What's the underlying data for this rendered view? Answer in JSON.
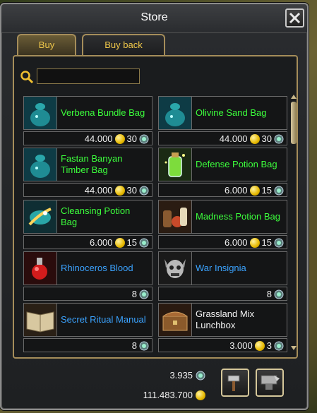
{
  "window": {
    "title": "Store"
  },
  "tabs": [
    {
      "label": "Buy",
      "active": true
    },
    {
      "label": "Buy back",
      "active": false
    }
  ],
  "search": {
    "value": "",
    "placeholder": ""
  },
  "items": [
    {
      "name": "Verbena Bundle Bag",
      "gold": "44.000",
      "gems": "30",
      "color": "green",
      "icon": "seed-bag-icon"
    },
    {
      "name": "Olivine Sand Bag",
      "gold": "44.000",
      "gems": "30",
      "color": "green",
      "icon": "seed-bag-icon"
    },
    {
      "name": "Fastan Banyan Timber Bag",
      "gold": "44.000",
      "gems": "30",
      "color": "green",
      "icon": "seed-bag-icon"
    },
    {
      "name": "Defense Potion Bag",
      "gold": "6.000",
      "gems": "15",
      "color": "green",
      "icon": "potion-bottle-icon"
    },
    {
      "name": "Cleansing Potion Bag",
      "gold": "6.000",
      "gems": "15",
      "color": "green",
      "icon": "elixir-icon"
    },
    {
      "name": "Madness Potion Bag",
      "gold": "6.000",
      "gems": "15",
      "color": "green",
      "icon": "potion-set-icon"
    },
    {
      "name": "Rhinoceros Blood",
      "gold": "",
      "gems": "8",
      "color": "blue",
      "icon": "blood-potion-icon"
    },
    {
      "name": "War Insignia",
      "gold": "",
      "gems": "8",
      "color": "blue",
      "icon": "skull-insignia-icon"
    },
    {
      "name": "Secret Ritual Manual",
      "gold": "",
      "gems": "8",
      "color": "blue",
      "icon": "open-book-icon"
    },
    {
      "name": "Grassland Mix Lunchbox",
      "gold": "3.000",
      "gems": "3",
      "color": "white",
      "icon": "lunchbox-icon"
    }
  ],
  "currency": {
    "gems": "3.935",
    "gold": "111.483.700"
  },
  "colors": {
    "border_gold": "#a58d5a",
    "name_green": "#3cff3c",
    "name_blue": "#3ba3ff",
    "tab_text": "#f0c84a"
  }
}
